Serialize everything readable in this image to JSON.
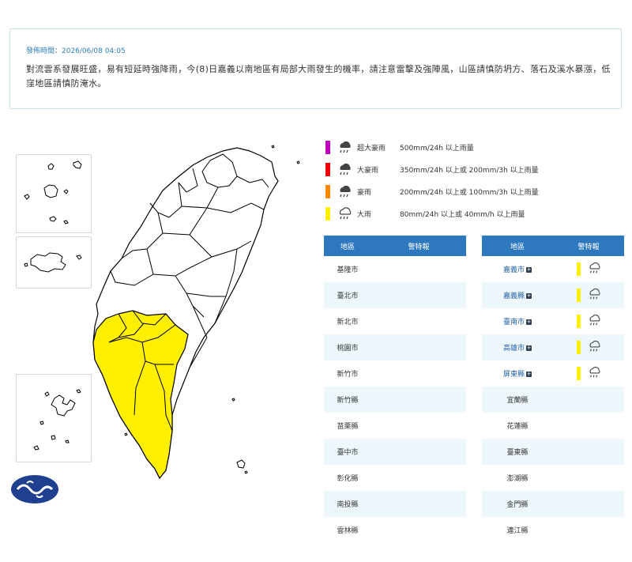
{
  "notice": {
    "time_label": "發佈時間：2026/06/08 04:05",
    "text": "對流雲系發展旺盛，易有短延時強降雨，今(8)日嘉義以南地區有局部大雨發生的機率，請注意雷擊及強陣風，山區請慎防坍方、落石及溪水暴漲，低窪地區請慎防淹水。"
  },
  "legend": [
    {
      "level": "超大豪雨",
      "desc": "500mm/24h 以上雨量",
      "color": "#c000c0",
      "icon": "rain-cloud-icon"
    },
    {
      "level": "大豪雨",
      "desc": "350mm/24h 以上或 200mm/3h 以上雨量",
      "color": "#ee0000",
      "icon": "rain-cloud-icon"
    },
    {
      "level": "豪雨",
      "desc": "200mm/24h 以上或 100mm/3h 以上雨量",
      "color": "#ff8800",
      "icon": "rain-cloud-icon"
    },
    {
      "level": "大雨",
      "desc": "80mm/24h 以上或 40mm/h 以上雨量",
      "color": "#ffef00",
      "icon": "rain-cloud-outline-icon"
    }
  ],
  "table": {
    "col_region": "地區",
    "col_warning": "警特報",
    "left": [
      "基隆市",
      "臺北市",
      "新北市",
      "桃園市",
      "新竹市",
      "新竹縣",
      "苗栗縣",
      "臺中市",
      "彰化縣",
      "南投縣",
      "雲林縣"
    ],
    "right": [
      {
        "name": "嘉義市",
        "warned": true
      },
      {
        "name": "嘉義縣",
        "warned": true
      },
      {
        "name": "臺南市",
        "warned": true
      },
      {
        "name": "高雄市",
        "warned": true
      },
      {
        "name": "屏東縣",
        "warned": true
      },
      {
        "name": "宜蘭縣",
        "warned": false
      },
      {
        "name": "花蓮縣",
        "warned": false
      },
      {
        "name": "臺東縣",
        "warned": false
      },
      {
        "name": "澎湖縣",
        "warned": false
      },
      {
        "name": "金門縣",
        "warned": false
      },
      {
        "name": "連江縣",
        "warned": false
      }
    ]
  },
  "colors": {
    "heavy_rain": "#ffef00",
    "header_blue": "#2e78be",
    "row_alt": "#eef8fc"
  }
}
